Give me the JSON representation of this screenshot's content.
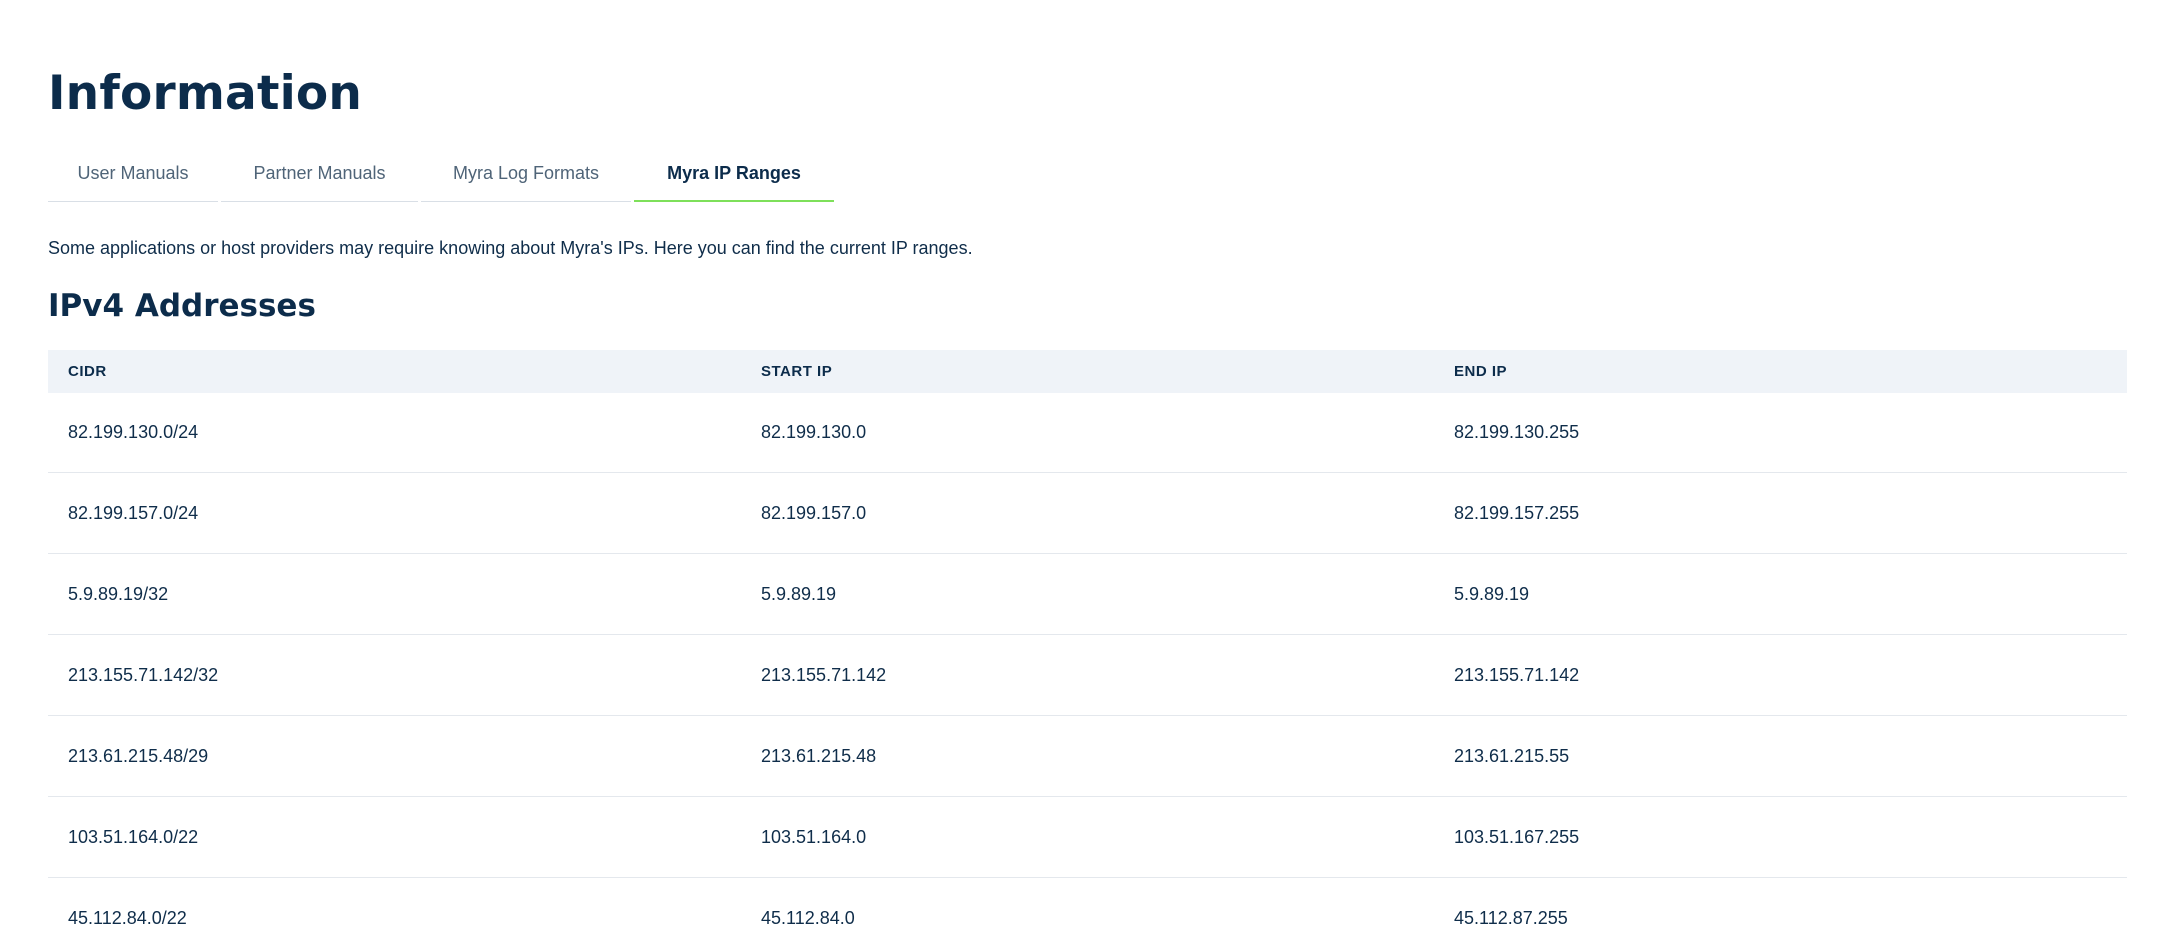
{
  "page": {
    "title": "Information"
  },
  "tabs": [
    {
      "label": "User Manuals",
      "active": false
    },
    {
      "label": "Partner Manuals",
      "active": false
    },
    {
      "label": "Myra Log Formats",
      "active": false
    },
    {
      "label": "Myra IP Ranges",
      "active": true
    }
  ],
  "intro": "Some applications or host providers may require knowing about Myra's IPs. Here you can find the current IP ranges.",
  "ipv4": {
    "title": "IPv4 Addresses",
    "columns": [
      "CIDR",
      "START IP",
      "END IP"
    ],
    "rows": [
      [
        "82.199.130.0/24",
        "82.199.130.0",
        "82.199.130.255"
      ],
      [
        "82.199.157.0/24",
        "82.199.157.0",
        "82.199.157.255"
      ],
      [
        "5.9.89.19/32",
        "5.9.89.19",
        "5.9.89.19"
      ],
      [
        "213.155.71.142/32",
        "213.155.71.142",
        "213.155.71.142"
      ],
      [
        "213.61.215.48/29",
        "213.61.215.48",
        "213.61.215.55"
      ],
      [
        "103.51.164.0/22",
        "103.51.164.0",
        "103.51.167.255"
      ],
      [
        "45.112.84.0/22",
        "45.112.84.0",
        "45.112.87.255"
      ]
    ]
  },
  "colors": {
    "heading": "#0c2c4b",
    "active_tab_underline": "#7ee05a",
    "table_header_bg": "#eff3f8"
  }
}
